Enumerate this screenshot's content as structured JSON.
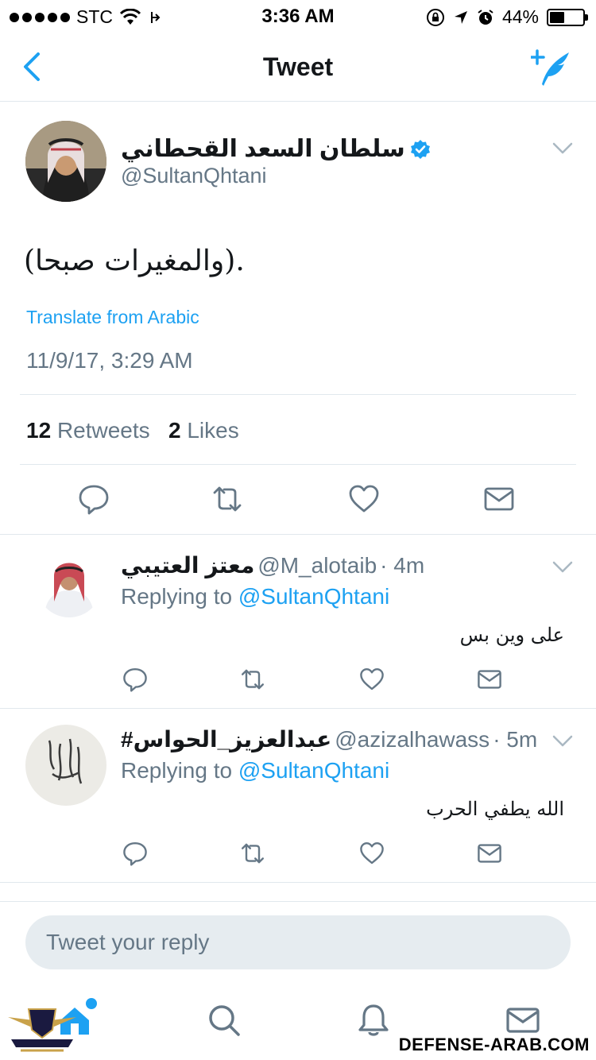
{
  "status_bar": {
    "carrier": "STC",
    "time": "3:36 AM",
    "battery": "44%",
    "battery_level": 0.44
  },
  "nav": {
    "title": "Tweet",
    "back_icon": "chevron-left-icon",
    "compose_icon": "compose-tweet-icon"
  },
  "main_tweet": {
    "display_name": "سلطان السعد القحطاني",
    "handle": "@SultanQhtani",
    "verified": true,
    "text": "(والمغيرات صبحا).",
    "translate": "Translate from Arabic",
    "timestamp": "11/9/17, 3:29 AM",
    "retweets_count": "12",
    "retweets_label": "Retweets",
    "likes_count": "2",
    "likes_label": "Likes"
  },
  "replies": [
    {
      "display_name": "معتز العتيبي",
      "handle": "@M_alotaib",
      "time": "· 4m",
      "replying_prefix": "Replying to",
      "replying_to": "@SultanQhtani",
      "text": "على وين بس"
    },
    {
      "display_name": "#عبدالعزيز_الحواس",
      "handle": "@azizalhawass",
      "time": "· 5m",
      "replying_prefix": "Replying to",
      "replying_to": "@SultanQhtani",
      "text": "الله يطفي الحرب"
    }
  ],
  "reply_box": {
    "placeholder": "Tweet your reply"
  },
  "tabs": [
    "home-icon",
    "search-icon",
    "notifications-icon",
    "messages-icon"
  ],
  "watermark": {
    "text": "DEFENSE-ARAB.COM"
  },
  "colors": {
    "accent": "#1da1f2",
    "secondary_text": "#657786",
    "divider": "#e1e8ed"
  }
}
